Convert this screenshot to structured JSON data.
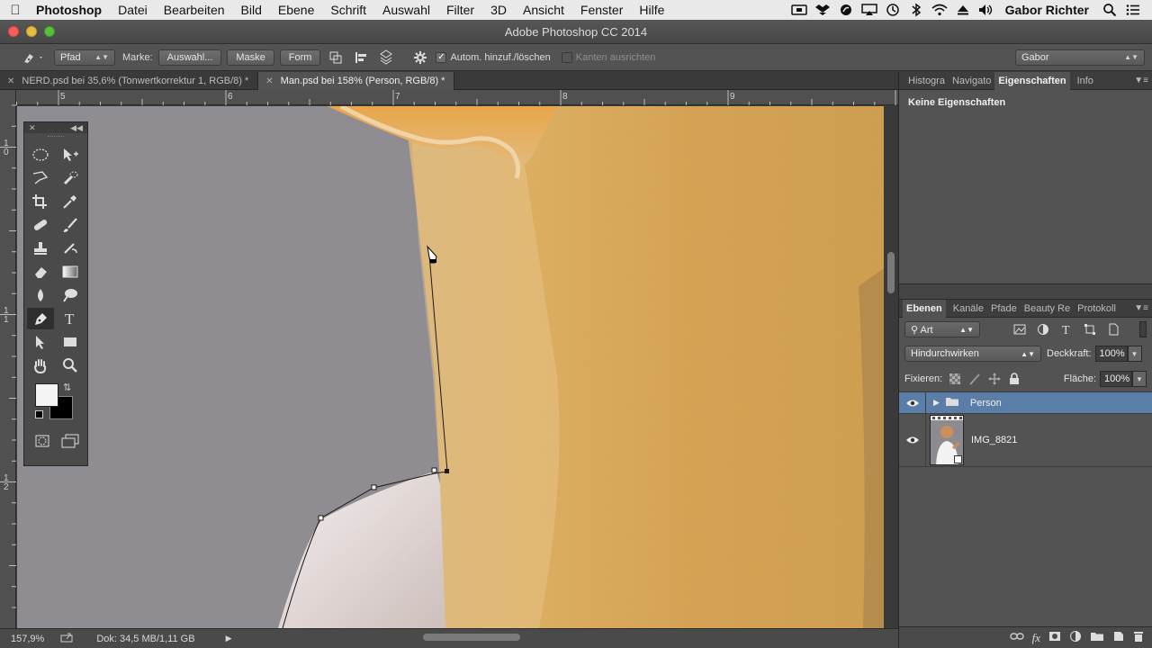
{
  "menubar": {
    "app": "Photoshop",
    "items": [
      "Datei",
      "Bearbeiten",
      "Bild",
      "Ebene",
      "Schrift",
      "Auswahl",
      "Filter",
      "3D",
      "Ansicht",
      "Fenster",
      "Hilfe"
    ],
    "user": "Gabor Richter"
  },
  "window": {
    "title": "Adobe Photoshop CC 2014"
  },
  "options": {
    "mode": "Pfad",
    "mark_label": "Marke:",
    "btn_selection": "Auswahl...",
    "btn_mask": "Maske",
    "btn_shape": "Form",
    "auto_add_label": "Autom. hinzuf./löschen",
    "auto_add_checked": true,
    "align_edges_label": "Kanten ausrichten",
    "align_edges_checked": false,
    "workspace": "Gabor"
  },
  "doctabs": [
    {
      "label": "NERD.psd bei 35,6% (Tonwertkorrektur 1, RGB/8) *",
      "active": false
    },
    {
      "label": "Man.psd bei 158% (Person, RGB/8) *",
      "active": true
    }
  ],
  "ruler_top": [
    "5",
    "6",
    "7",
    "8",
    "9"
  ],
  "ruler_left": [
    "1\n0",
    "1\n1",
    "1\n2"
  ],
  "status": {
    "zoom": "157,9%",
    "doc": "Dok: 34,5 MB/1,11 GB"
  },
  "panels": {
    "top_tabs": [
      "Histogra",
      "Navigato",
      "Eigenschaften",
      "Info"
    ],
    "top_active": 2,
    "properties_text": "Keine Eigenschaften",
    "layer_tabs": [
      "Ebenen",
      "Kanäle",
      "Pfade",
      "Beauty Re",
      "Protokoll"
    ],
    "layer_active": 0,
    "filter_kind": "Art",
    "blend_mode": "Hindurchwirken",
    "opacity_label": "Deckkraft:",
    "opacity": "100%",
    "lock_label": "Fixieren:",
    "fill_label": "Fläche:",
    "fill": "100%",
    "layers": [
      {
        "name": "Person",
        "type": "group",
        "selected": true
      },
      {
        "name": "IMG_8821",
        "type": "smart-object",
        "selected": false
      }
    ]
  },
  "colors": {
    "foreground": "#f4f4f4",
    "background": "#000000",
    "selection": "#5b7ea8"
  }
}
